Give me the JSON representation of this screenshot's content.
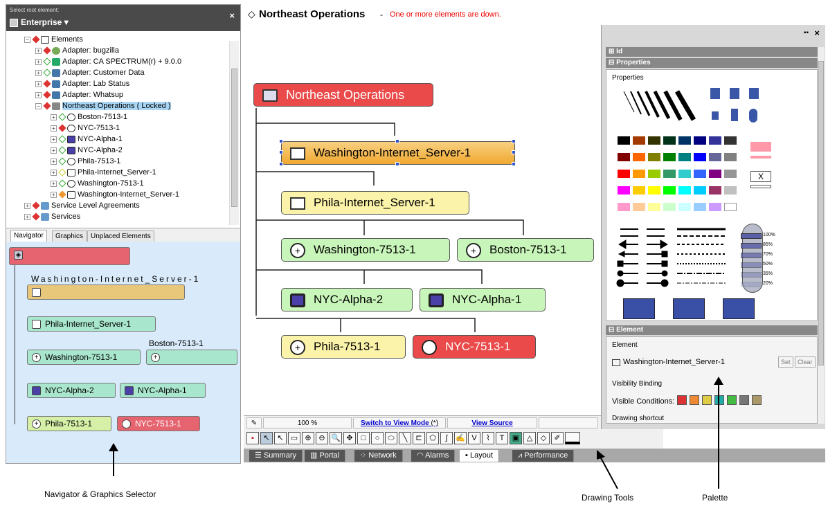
{
  "root_selector": {
    "label": "Select root element:",
    "value": "Enterprise",
    "close": "×"
  },
  "tree": {
    "items": [
      {
        "label": "Elements",
        "indent": 0
      },
      {
        "label": "Adapter: bugzilla",
        "indent": 1
      },
      {
        "label": "Adapter: CA SPECTRUM(r) + 9.0.0",
        "indent": 1
      },
      {
        "label": "Adapter: Customer Data",
        "indent": 1
      },
      {
        "label": "Adapter: Lab Status",
        "indent": 1
      },
      {
        "label": "Adapter: Whatsup",
        "indent": 1
      },
      {
        "label": "Northeast Operations ( Locked )",
        "indent": 1
      },
      {
        "label": "Boston-7513-1",
        "indent": 2
      },
      {
        "label": "NYC-7513-1",
        "indent": 2
      },
      {
        "label": "NYC-Alpha-1",
        "indent": 2
      },
      {
        "label": "NYC-Alpha-2",
        "indent": 2
      },
      {
        "label": "Phila-7513-1",
        "indent": 2
      },
      {
        "label": "Phila-Internet_Server-1",
        "indent": 2
      },
      {
        "label": "Washington-7513-1",
        "indent": 2
      },
      {
        "label": "Washington-Internet_Server-1",
        "indent": 2
      },
      {
        "label": "Service Level Agreements",
        "indent": 0
      },
      {
        "label": "Services",
        "indent": 0
      }
    ]
  },
  "left_tabs": [
    "Navigator",
    "Graphics",
    "Unplaced Elements"
  ],
  "navigator": {
    "nodes": [
      "Washington-Internet_Server-1",
      "Phila-Internet_Server-1",
      "Boston-7513-1",
      "Washington-7513-1",
      "NYC-Alpha-2",
      "NYC-Alpha-1",
      "Phila-7513-1",
      "NYC-7513-1"
    ]
  },
  "header": {
    "title": "Northeast Operations",
    "separator": "-",
    "status": "One or more elements are down."
  },
  "canvas": {
    "nodes": {
      "root": "Northeast Operations",
      "wis": "Washington-Internet_Server-1",
      "pis": "Phila-Internet_Server-1",
      "w7513": "Washington-7513-1",
      "b7513": "Boston-7513-1",
      "alpha2": "NYC-Alpha-2",
      "alpha1": "NYC-Alpha-1",
      "p7513": "Phila-7513-1",
      "n7513": "NYC-7513-1"
    }
  },
  "statusbar": {
    "zoom": "100 %",
    "switch": "Switch to View Mode",
    "modified": "(*)",
    "view_source": "View Source"
  },
  "bottom_tabs": [
    "Summary",
    "Portal",
    "Network",
    "Alarms",
    "Layout",
    "Performance"
  ],
  "active_bottom_tab": "Layout",
  "palette": {
    "sections": {
      "id": "Id",
      "properties": "Properties",
      "element": "Element"
    },
    "properties_label": "Properties",
    "fill_levels": [
      "100%",
      "85%",
      "70%",
      "50%",
      "35%",
      "20%"
    ],
    "x_label": "X",
    "element_label": "Element",
    "element_value": "Washington-Internet_Server-1",
    "set_button": "Set",
    "clear_button": "Clear",
    "visibility_label": "Visibility Binding",
    "visible_conditions": "Visible Conditions:",
    "drawing_shortcut": "Drawing shortcut"
  },
  "annotations": {
    "navigator": "Navigator & Graphics Selector",
    "tools": "Drawing Tools",
    "palette": "Palette"
  },
  "colors": {
    "red_node": "#ea4a4a",
    "yellow_node": "#fbf3a9",
    "green_node": "#c8f5b9",
    "nav_bg": "#d9ebfa",
    "status_red": "#e00000"
  }
}
